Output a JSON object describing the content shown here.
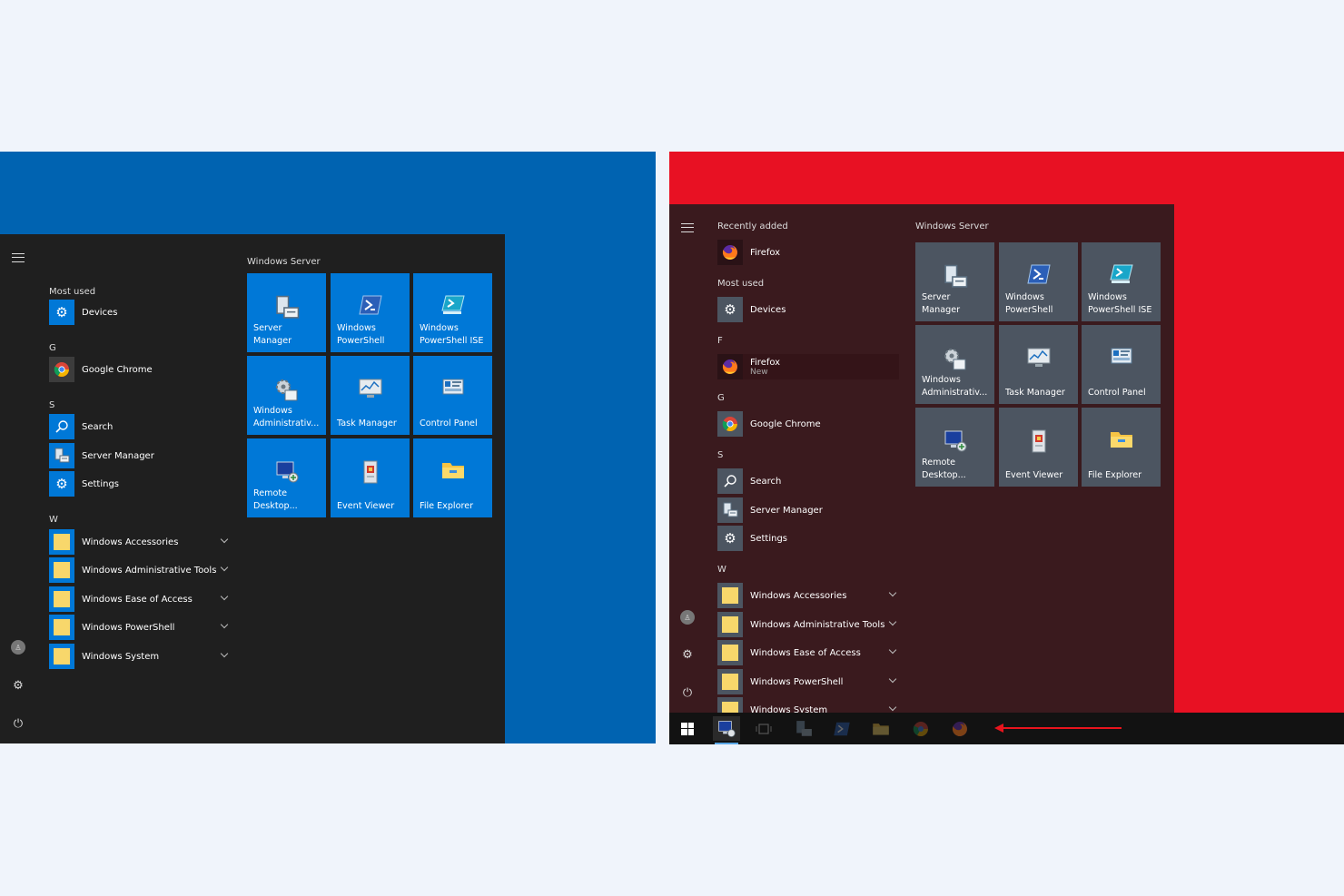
{
  "colors": {
    "page_bg": "#f0f4fb",
    "left_desktop": "#0063b1",
    "right_desktop": "#e81123",
    "left_start_bg": "#1f1f1f",
    "right_start_bg": "#3a1a1e",
    "left_tile": "#0078d7",
    "right_tile": "#4c5561",
    "taskbar": "#121212",
    "arrow": "#e8141d"
  },
  "left": {
    "most_used_header": "Most used",
    "rows": [
      {
        "label": "Devices",
        "icon": "gear-icon"
      },
      {
        "label": "Google Chrome",
        "icon": "chrome-icon"
      },
      {
        "label": "Search",
        "icon": "search-icon"
      },
      {
        "label": "Server Manager",
        "icon": "server-manager-icon"
      },
      {
        "label": "Settings",
        "icon": "gear-icon"
      },
      {
        "label": "Windows Accessories",
        "icon": "folder-icon"
      },
      {
        "label": "Windows Administrative Tools",
        "icon": "folder-icon"
      },
      {
        "label": "Windows Ease of Access",
        "icon": "folder-icon"
      },
      {
        "label": "Windows PowerShell",
        "icon": "folder-icon"
      },
      {
        "label": "Windows System",
        "icon": "folder-icon"
      }
    ],
    "letters": [
      "G",
      "S",
      "W"
    ],
    "tiles_title": "Windows Server",
    "tiles": [
      "Server Manager",
      "Windows\nPowerShell",
      "Windows\nPowerShell ISE",
      "Windows\nAdministrativ...",
      "Task Manager",
      "Control Panel",
      "Remote\nDesktop...",
      "Event Viewer",
      "File Explorer"
    ]
  },
  "right": {
    "recently_added_header": "Recently added",
    "most_used_header": "Most used",
    "rows": [
      {
        "label": "Firefox",
        "icon": "firefox-icon"
      },
      {
        "label": "Devices",
        "icon": "gear-icon"
      },
      {
        "label": "Firefox",
        "icon": "firefox-icon",
        "sub": "New"
      },
      {
        "label": "Google Chrome",
        "icon": "chrome-icon"
      },
      {
        "label": "Search",
        "icon": "search-icon"
      },
      {
        "label": "Server Manager",
        "icon": "server-manager-icon"
      },
      {
        "label": "Settings",
        "icon": "gear-icon"
      },
      {
        "label": "Windows Accessories",
        "icon": "folder-icon"
      },
      {
        "label": "Windows Administrative Tools",
        "icon": "folder-icon"
      },
      {
        "label": "Windows Ease of Access",
        "icon": "folder-icon"
      },
      {
        "label": "Windows PowerShell",
        "icon": "folder-icon"
      },
      {
        "label": "Windows System",
        "icon": "folder-icon"
      }
    ],
    "letters": [
      "F",
      "G",
      "S",
      "W"
    ],
    "tiles_title": "Windows Server",
    "tiles": [
      "Server Manager",
      "Windows\nPowerShell",
      "Windows\nPowerShell ISE",
      "Windows\nAdministrativ...",
      "Task Manager",
      "Control Panel",
      "Remote\nDesktop...",
      "Event Viewer",
      "File Explorer"
    ]
  },
  "taskbar_icons": [
    "windows-start-icon",
    "remote-desktop-icon",
    "task-view-icon",
    "server-manager-icon",
    "powershell-icon",
    "file-explorer-icon",
    "chrome-icon",
    "firefox-icon"
  ]
}
